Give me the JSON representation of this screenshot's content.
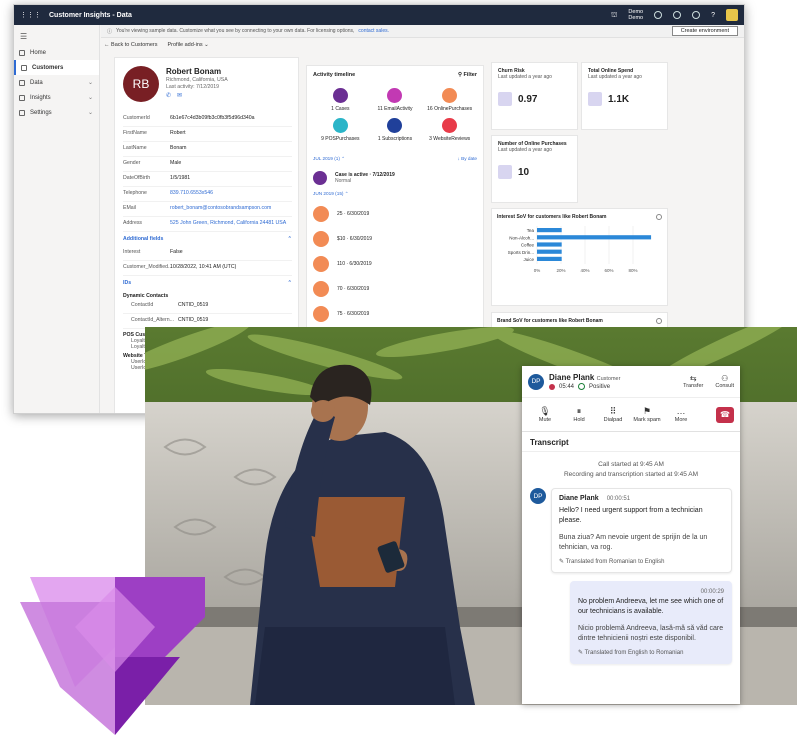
{
  "app": {
    "title": "Customer Insights - Data",
    "user_line1": "Demo",
    "user_line2": "Demo",
    "env_button": "Create environment"
  },
  "banner": {
    "text": "You're viewing sample data. Customize what you see by connecting to your own data. For licensing options,",
    "link": "contact sales."
  },
  "nav": {
    "items": [
      {
        "label": "Home",
        "active": false,
        "chev": ""
      },
      {
        "label": "Customers",
        "active": true,
        "chev": ""
      },
      {
        "label": "Data",
        "active": false,
        "chev": "⌄"
      },
      {
        "label": "Insights",
        "active": false,
        "chev": "⌄"
      },
      {
        "label": "Settings",
        "active": false,
        "chev": "⌄"
      }
    ]
  },
  "crumbs": {
    "back": "← Back to Customers",
    "profile": "Profile add-ins ⌄"
  },
  "profile": {
    "initials": "RB",
    "name": "Robert Bonam",
    "location": "Richmond, California, USA",
    "last_activity": "Last activity: 7/12/2019",
    "fields": [
      {
        "k": "CustomerId",
        "v": "6b1e67c4d3b09fb3c0fb3f5d96d340a",
        "link": false
      },
      {
        "k": "FirstName",
        "v": "Robert",
        "link": false
      },
      {
        "k": "LastName",
        "v": "Bonam",
        "link": false
      },
      {
        "k": "Gender",
        "v": "Male",
        "link": false
      },
      {
        "k": "DateOfBirth",
        "v": "1/5/1981",
        "link": false
      },
      {
        "k": "Telephone",
        "v": "839.710.6553x546",
        "link": true
      },
      {
        "k": "EMail",
        "v": "robert_bonam@contosobrandsampson.com",
        "link": true
      },
      {
        "k": "Address",
        "v": "525 John Green, Richmond, California 24481 USA",
        "link": true
      }
    ],
    "additional_label": "Additional fields",
    "additional": [
      {
        "k": "Interest",
        "v": "False"
      },
      {
        "k": "Customer_Modified...",
        "v": "10/28/2022, 10:41 AM (UTC)"
      }
    ],
    "ids_label": "IDs",
    "dyn_label": "Dynamic Contacts",
    "dyn": [
      {
        "k": "ContactId",
        "v": "CNTID_0519"
      },
      {
        "k": "ContactId_Altern...",
        "v": "CNTID_0519"
      }
    ],
    "pos_label": "POS Customers",
    "pos": [
      "LoyaltyId",
      "LoyaltyId..."
    ],
    "web_label": "Website Ti...",
    "web": [
      "UserId",
      "UserId..."
    ]
  },
  "activity": {
    "title": "Activity timeline",
    "filter": "Filter",
    "categories": [
      {
        "label": "1 Cases",
        "color": "#6b2f93"
      },
      {
        "label": "11 EmailActivity",
        "color": "#c239b3"
      },
      {
        "label": "16 OnlinePurchases",
        "color": "#f28b55"
      },
      {
        "label": "9 POSPurchases",
        "color": "#2bb5c8"
      },
      {
        "label": "1 Subscriptions",
        "color": "#20409a"
      },
      {
        "label": "3 WebsiteReviews",
        "color": "#e83b49"
      }
    ],
    "jul": "JUL 2019 (1) ⌃",
    "sort": "↓ By date",
    "case_title": "Case is active · 7/12/2019",
    "case_sub": "Normal",
    "jun": "JUN 2019 (15) ⌃",
    "items": [
      "25 · 6/30/2019",
      "$10 · 6/30/2019",
      "110 · 6/30/2019",
      "70 · 6/30/2019",
      "75 · 6/30/2019"
    ]
  },
  "kpis": {
    "churn": {
      "title": "Churn Risk",
      "sub": "Last updated a year ago",
      "value": "0.97"
    },
    "spend": {
      "title": "Total Online Spend",
      "sub": "Last updated a year ago",
      "value": "1.1K"
    },
    "purchases": {
      "title": "Number of Online Purchases",
      "sub": "Last updated a year ago",
      "value": "10"
    }
  },
  "brand": {
    "title": "Brand SoV for customers like Robert Bonam"
  },
  "chart_data": {
    "type": "bar",
    "orientation": "horizontal",
    "title": "Interest SoV for customers like Robert Bonam",
    "categories": [
      "Tea",
      "Non-Alcoh...",
      "Coffee",
      "Sports Drin...",
      "Juice"
    ],
    "values": [
      0.21,
      0.97,
      0.21,
      0.21,
      0.21
    ],
    "xticks": [
      "0%",
      "20%",
      "40%",
      "60%",
      "80%"
    ],
    "xlim": [
      0,
      1
    ],
    "grid": true,
    "color": "#2b88d8"
  },
  "call": {
    "name": "Diane Plank",
    "role": "Customer",
    "initials": "DP",
    "timer": "05:44",
    "sentiment": "Positive",
    "transfer": "Transfer",
    "consult": "Consult",
    "tools": [
      "Mute",
      "Hold",
      "Dialpad",
      "Mark spam",
      "More"
    ],
    "transcript_title": "Transcript",
    "status1": "Call started at 9:45 AM",
    "status2": "Recording and transcription started at 9:45 AM",
    "m1": {
      "who": "Diane Plank",
      "time": "00:00:51",
      "text": "Hello? I need urgent support from a technician please.",
      "orig": "Buna ziua? Am nevoie urgent de sprijin de la un tehnician, va rog.",
      "trans": "Translated from Romanian to English"
    },
    "m2": {
      "time": "00:00:29",
      "text": "No problem Andreeva, let me see which one of our technicians is available.",
      "orig": "Nicio problemă Andreeva, lasă-mă să văd care dintre tehnicienii noștri este disponibil.",
      "trans": "Translated from English to Romanian"
    }
  },
  "colors": {
    "topbar": "#1f2a3e",
    "accent": "#2f6bd3",
    "avatar": "#781f24",
    "end_call": "#c4314b"
  }
}
